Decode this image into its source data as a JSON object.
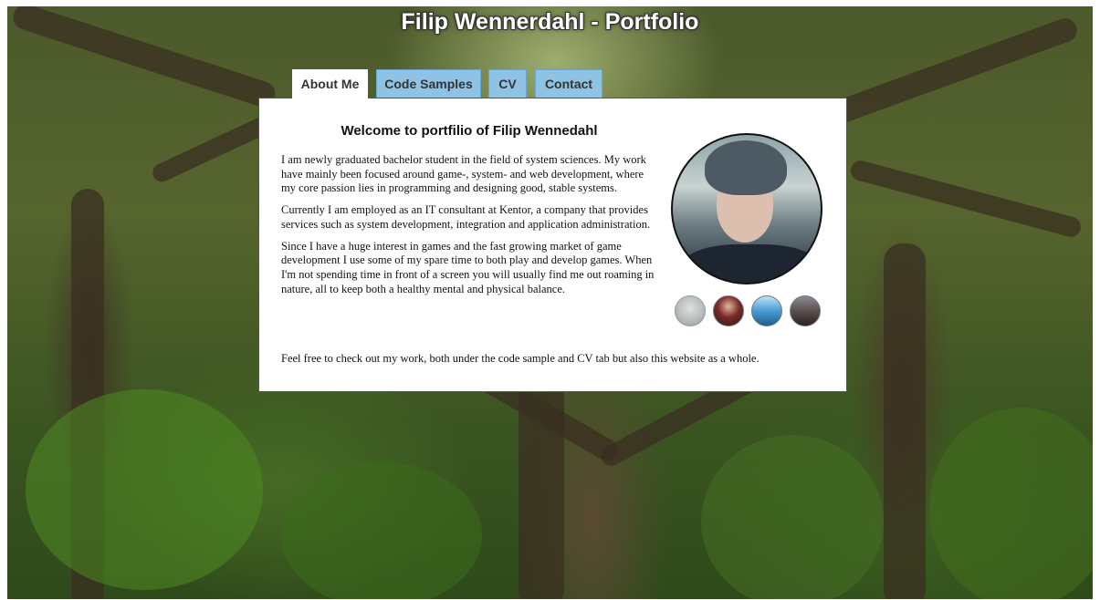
{
  "site": {
    "title": "Filip Wennerdahl - Portfolio"
  },
  "tabs": [
    {
      "label": "About Me",
      "active": true
    },
    {
      "label": "Code Samples",
      "active": false
    },
    {
      "label": "CV",
      "active": false
    },
    {
      "label": "Contact",
      "active": false
    }
  ],
  "about": {
    "heading": "Welcome to portfilio of Filip Wennedahl",
    "paragraphs": [
      "I am newly graduated bachelor student in the field of system sciences. My work have mainly been focused around game-, system- and web development, where my core passion lies in programming and designing good, stable systems.",
      "Currently I am employed as an IT consultant at Kentor, a company that provides services such as system development, integration and application administration.",
      "Since I have a huge interest in games and the fast growing market of game development I use some of my spare time to both play and develop games. When I'm not spending time in front of a screen you will usually find me out roaming in nature, all to keep both a healthy mental and physical balance."
    ],
    "closing": "Feel free to check out my work, both under the code sample and CV tab but also this website as a whole."
  },
  "colors": {
    "tab_inactive": "#8fc3e6",
    "tab_active": "#ffffff",
    "panel_bg": "#ffffff",
    "title_text": "#ffffff"
  },
  "icons": {
    "profile_photo": "profile-photo-icon",
    "thumbnails": [
      "thumbnail-portrait-grey-icon",
      "thumbnail-portrait-suit-icon",
      "thumbnail-landscape-blue-icon",
      "thumbnail-city-night-icon"
    ]
  }
}
